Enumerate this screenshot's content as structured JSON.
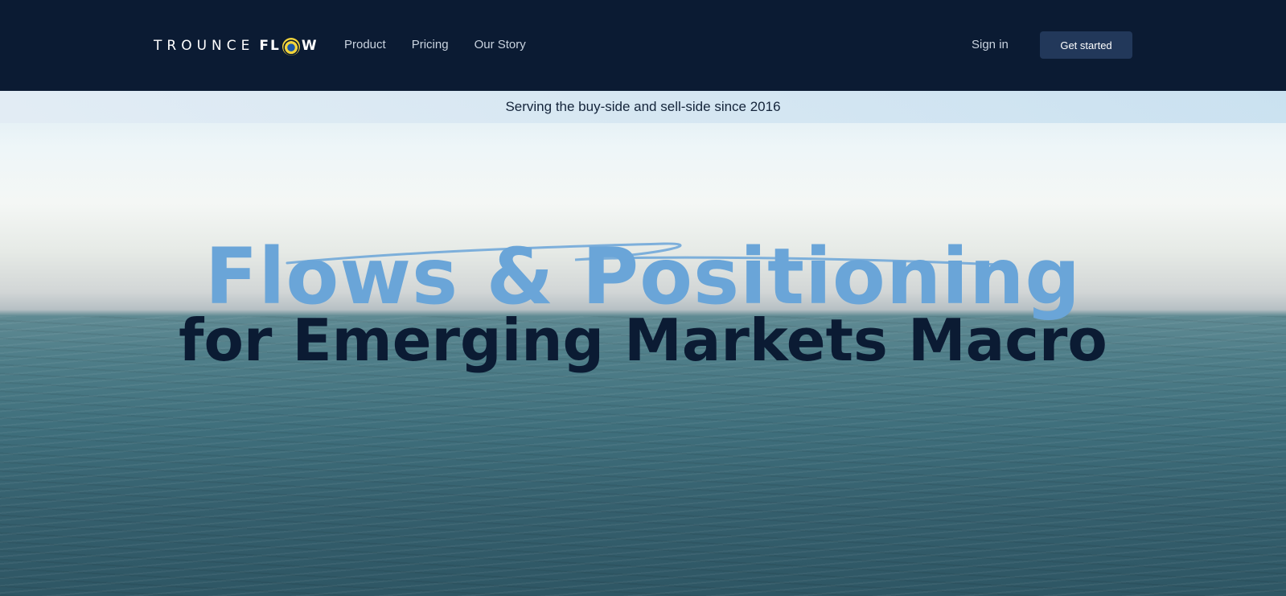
{
  "nav": {
    "logo_part1": "TROUNCE",
    "logo_part2_pre": "FL",
    "logo_part2_post": "W",
    "links": [
      "Product",
      "Pricing",
      "Our Story"
    ],
    "sign_in": "Sign in",
    "cta": "Get started"
  },
  "banner": {
    "text": "Serving the buy-side and sell-side since 2016"
  },
  "hero": {
    "headline_accent": "Flows & Positioning",
    "headline_main": "for Emerging Markets Macro"
  },
  "colors": {
    "nav_bg": "#0b1b33",
    "accent": "#6aa5d8",
    "cta_bg": "#22385a",
    "logo_ring": "#f2d43a"
  }
}
